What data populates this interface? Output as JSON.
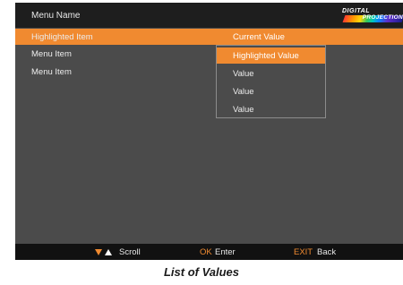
{
  "title_bar": {
    "menu_name": "Menu Name",
    "logo_line1": "DIGITAL",
    "logo_line2": "PROJECTION"
  },
  "menu": {
    "items": [
      {
        "label": "Highlighted Item",
        "value": "Current Value",
        "highlighted": true
      },
      {
        "label": "Menu Item",
        "value": "",
        "highlighted": false
      },
      {
        "label": "Menu Item",
        "value": "",
        "highlighted": false
      }
    ]
  },
  "dropdown": {
    "options": [
      {
        "label": "Highlighted Value",
        "selected": true
      },
      {
        "label": "Value",
        "selected": false
      },
      {
        "label": "Value",
        "selected": false
      },
      {
        "label": "Value",
        "selected": false
      }
    ]
  },
  "footer": {
    "scroll_icon": "up-down-arrows-icon",
    "scroll_label": "Scroll",
    "ok_key": "OK",
    "ok_label": "Enter",
    "exit_key": "EXIT",
    "exit_label": "Back"
  },
  "caption": "List of Values",
  "colors": {
    "accent": "#f08a30",
    "panel": "#4b4b4b",
    "title_bar": "#1e1e1e",
    "footer": "#111111"
  }
}
